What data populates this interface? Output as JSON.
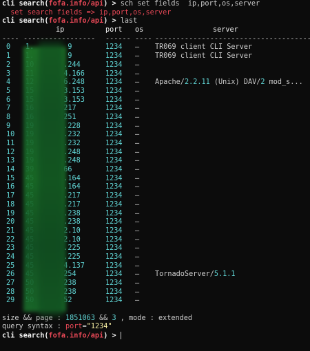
{
  "prompt": {
    "name": "cli search(",
    "api": "fofa.info/api",
    "close": ") > "
  },
  "commands": {
    "cmd1": "sch set fields  ip,port,os,server",
    "cmd1_out": "  set search fields => ip,port,os,server",
    "cmd2": "last"
  },
  "table": {
    "headers": {
      "idx": "",
      "ip": "ip",
      "port": "port",
      "os": "os",
      "server": "server"
    },
    "separator": {
      "idx": "----",
      "ip": "-----------------",
      "port": "------",
      "os": "----",
      "server": "-------------------------------------"
    },
    "rows": [
      {
        "idx": "0",
        "ip": "1.        9",
        "port": "1234",
        "os": "–",
        "server": "TR069 client CLI Server"
      },
      {
        "idx": "1",
        "ip": "1.        9",
        "port": "1234",
        "os": "–",
        "server": "TR069 client CLI Server"
      },
      {
        "idx": "2",
        "ip": "10       .244",
        "port": "1234",
        "os": "–",
        "server": ""
      },
      {
        "idx": "3",
        "ip": "11       4.166",
        "port": "1234",
        "os": "–",
        "server": ""
      },
      {
        "idx": "4",
        "ip": "12       6.248",
        "port": "1234",
        "os": "–",
        "server": "Apache/2.2.11 (Unix) DAV/2 mod_s..."
      },
      {
        "idx": "5",
        "ip": "15       3.153",
        "port": "1234",
        "os": "–",
        "server": ""
      },
      {
        "idx": "6",
        "ip": "15       3.153",
        "port": "1234",
        "os": "–",
        "server": ""
      },
      {
        "idx": "7",
        "ip": "16       217",
        "port": "1234",
        "os": "–",
        "server": ""
      },
      {
        "idx": "8",
        "ip": "16       251",
        "port": "1234",
        "os": "–",
        "server": ""
      },
      {
        "idx": "9",
        "ip": "19       .228",
        "port": "1234",
        "os": "–",
        "server": ""
      },
      {
        "idx": "10",
        "ip": "19       .232",
        "port": "1234",
        "os": "–",
        "server": ""
      },
      {
        "idx": "11",
        "ip": "19       .232",
        "port": "1234",
        "os": "–",
        "server": ""
      },
      {
        "idx": "12",
        "ip": "19       .248",
        "port": "1234",
        "os": "–",
        "server": ""
      },
      {
        "idx": "13",
        "ip": "19       .248",
        "port": "1234",
        "os": "–",
        "server": ""
      },
      {
        "idx": "14",
        "ip": "39       66",
        "port": "1234",
        "os": "–",
        "server": ""
      },
      {
        "idx": "15",
        "ip": "45       .164",
        "port": "1234",
        "os": "–",
        "server": ""
      },
      {
        "idx": "16",
        "ip": "45       .164",
        "port": "1234",
        "os": "–",
        "server": ""
      },
      {
        "idx": "17",
        "ip": "45       .217",
        "port": "1234",
        "os": "–",
        "server": ""
      },
      {
        "idx": "18",
        "ip": "45       .217",
        "port": "1234",
        "os": "–",
        "server": ""
      },
      {
        "idx": "19",
        "ip": "45       .238",
        "port": "1234",
        "os": "–",
        "server": ""
      },
      {
        "idx": "20",
        "ip": "45       .238",
        "port": "1234",
        "os": "–",
        "server": ""
      },
      {
        "idx": "21",
        "ip": "45       2.10",
        "port": "1234",
        "os": "–",
        "server": ""
      },
      {
        "idx": "22",
        "ip": "45       2.10",
        "port": "1234",
        "os": "–",
        "server": ""
      },
      {
        "idx": "23",
        "ip": "45       .225",
        "port": "1234",
        "os": "–",
        "server": ""
      },
      {
        "idx": "24",
        "ip": "45       .225",
        "port": "1234",
        "os": "–",
        "server": ""
      },
      {
        "idx": "25",
        "ip": "45       4.137",
        "port": "1234",
        "os": "–",
        "server": ""
      },
      {
        "idx": "26",
        "ip": "45       254",
        "port": "1234",
        "os": "–",
        "server": "TornadoServer/5.1.1"
      },
      {
        "idx": "27",
        "ip": "50       238",
        "port": "1234",
        "os": "–",
        "server": ""
      },
      {
        "idx": "28",
        "ip": "50       238",
        "port": "1234",
        "os": "–",
        "server": ""
      },
      {
        "idx": "29",
        "ip": "50       52",
        "port": "1234",
        "os": "–",
        "server": ""
      }
    ]
  },
  "footer": {
    "size_label": "size && page : ",
    "size_value": "1851063",
    "and": " && ",
    "page_value": "3",
    "mode_label": " , mode : extended",
    "syntax_label": "query syntax : ",
    "syntax_key": "port",
    "syntax_eq": "=",
    "syntax_value": "\"1234\""
  },
  "colors": {
    "bg": "#0c0c0c",
    "text": "#cccccc",
    "cyan": "#61d6d6",
    "red": "#e74856",
    "yellow": "#f9f1a5",
    "redacted": "#1a6e28"
  }
}
